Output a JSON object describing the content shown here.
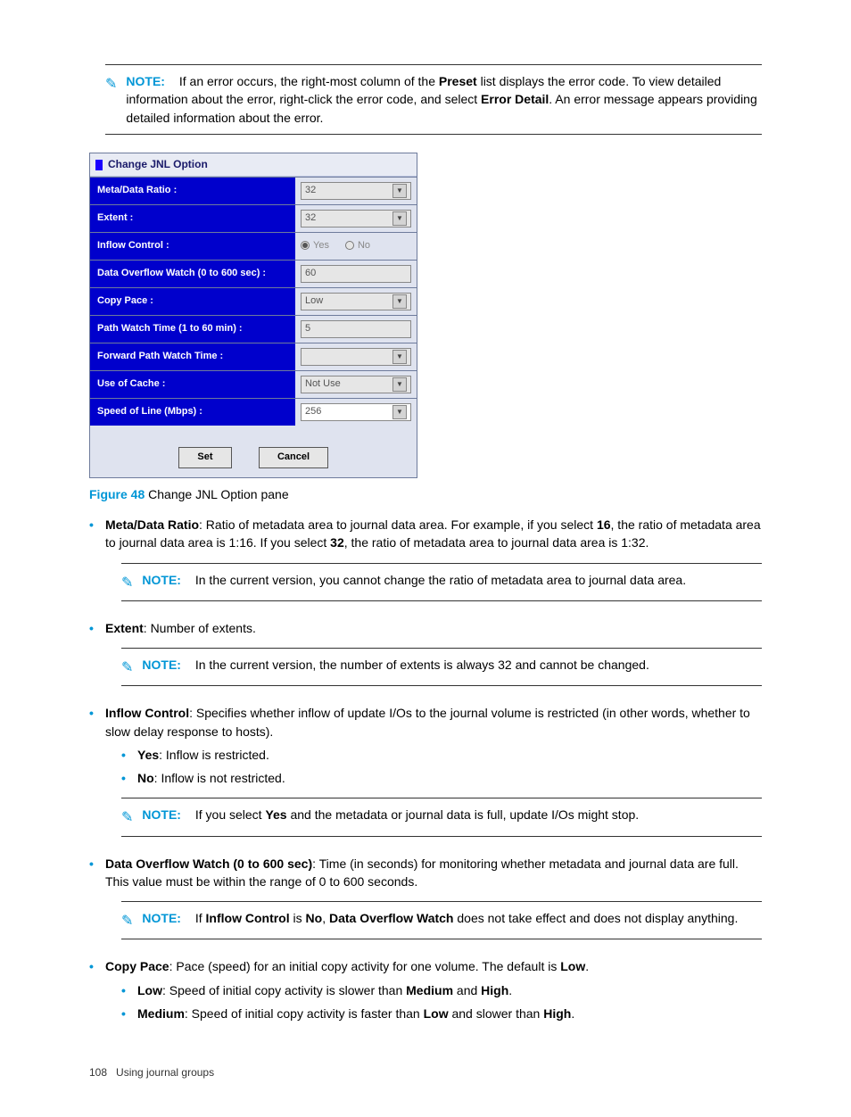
{
  "note1": {
    "label": "NOTE:",
    "t1": "If an error occurs, the right-most column of the ",
    "b1": "Preset",
    "t2": " list displays the error code. To view detailed information about the error, right-click the error code, and select ",
    "b2": "Error Detail",
    "t3": ". An error message appears providing detailed information about the error."
  },
  "dialog": {
    "title": "Change JNL Option",
    "rows": {
      "meta_label": "Meta/Data Ratio :",
      "meta_val": "32",
      "extent_label": "Extent :",
      "extent_val": "32",
      "inflow_label": "Inflow Control :",
      "inflow_yes": "Yes",
      "inflow_no": "No",
      "overflow_label": "Data Overflow Watch (0 to 600 sec) :",
      "overflow_val": "60",
      "copypace_label": "Copy Pace :",
      "copypace_val": "Low",
      "pathwatch_label": "Path Watch Time (1 to 60 min) :",
      "pathwatch_val": "5",
      "fwdpath_label": "Forward Path Watch Time :",
      "fwdpath_val": "",
      "cache_label": "Use of Cache :",
      "cache_val": "Not Use",
      "speed_label": "Speed of Line (Mbps) :",
      "speed_val": "256"
    },
    "set_btn": "Set",
    "cancel_btn": "Cancel"
  },
  "figure": {
    "label": "Figure 48",
    "caption": " Change JNL Option pane"
  },
  "bullets": {
    "meta": {
      "b1": "Meta/Data Ratio",
      "t1": ": Ratio of metadata area to journal data area. For example, if you select ",
      "b2": "16",
      "t2": ", the ratio of metadata area to journal data area is 1:16. If you select ",
      "b3": "32",
      "t3": ", the ratio of metadata area to journal data area is 1:32."
    },
    "extent": {
      "b1": "Extent",
      "t1": ": Number of extents."
    },
    "inflow": {
      "b1": "Inflow Control",
      "t1": ": Specifies whether inflow of update I/Os to the journal volume is restricted (in other words, whether to slow delay response to hosts).",
      "yes_b": "Yes",
      "yes_t": ": Inflow is restricted.",
      "no_b": "No",
      "no_t": ": Inflow is not restricted."
    },
    "overflow": {
      "b1": "Data Overflow Watch (0 to 600 sec)",
      "t1": ": Time (in seconds) for monitoring whether metadata and journal data are full. This value must be within the range of 0 to 600 seconds."
    },
    "copypace": {
      "b1": "Copy Pace",
      "t1": ": Pace (speed) for an initial copy activity for one volume. The default is ",
      "b2": "Low",
      "t2": ".",
      "low_b": "Low",
      "low_t1": ": Speed of initial copy activity is slower than ",
      "low_b2": "Medium",
      "low_t2": " and ",
      "low_b3": "High",
      "low_t3": ".",
      "med_b": "Medium",
      "med_t1": ": Speed of initial copy activity is faster than ",
      "med_b2": "Low",
      "med_t2": " and slower than ",
      "med_b3": "High",
      "med_t3": "."
    }
  },
  "note2": {
    "label": "NOTE:",
    "text": "In the current version, you cannot change the ratio of metadata area to journal data area."
  },
  "note3": {
    "label": "NOTE:",
    "text": "In the current version, the number of extents is always 32 and cannot be changed."
  },
  "note4": {
    "label": "NOTE:",
    "t1": "If you select ",
    "b1": "Yes",
    "t2": " and the metadata or journal data is full, update I/Os might stop."
  },
  "note5": {
    "label": "NOTE:",
    "t1": "If ",
    "b1": "Inflow Control",
    "t2": " is ",
    "b2": "No",
    "t3": ", ",
    "b3": "Data Overflow Watch",
    "t4": " does not take effect and does not display anything."
  },
  "footer": {
    "page": "108",
    "title": "Using journal groups"
  }
}
